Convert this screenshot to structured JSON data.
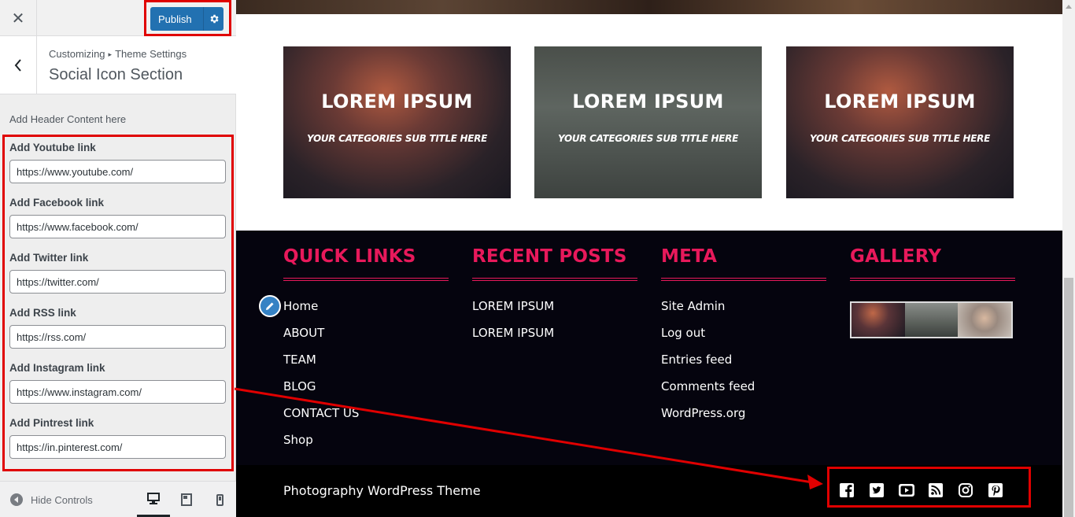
{
  "sidebar": {
    "close_label": "✕",
    "publish_label": "Publish",
    "breadcrumb_root": "Customizing",
    "breadcrumb_parent": "Theme Settings",
    "section_title": "Social Icon Section",
    "description": "Add Header Content here",
    "fields": [
      {
        "label": "Add Youtube link",
        "value": "https://www.youtube.com/"
      },
      {
        "label": "Add Facebook link",
        "value": "https://www.facebook.com/"
      },
      {
        "label": "Add Twitter link",
        "value": "https://twitter.com/"
      },
      {
        "label": "Add RSS link",
        "value": "https://rss.com/"
      },
      {
        "label": "Add Instagram link",
        "value": "https://www.instagram.com/"
      },
      {
        "label": "Add Pintrest link",
        "value": "https://in.pinterest.com/"
      }
    ],
    "hide_controls": "Hide Controls"
  },
  "preview": {
    "cards": [
      {
        "title": "LOREM IPSUM",
        "subtitle": "YOUR CATEGORIES SUB TITLE HERE"
      },
      {
        "title": "LOREM IPSUM",
        "subtitle": "YOUR CATEGORIES SUB TITLE HERE"
      },
      {
        "title": "LOREM IPSUM",
        "subtitle": "YOUR CATEGORIES SUB TITLE HERE"
      }
    ],
    "footer": {
      "quick_links_title": "QUICK LINKS",
      "quick_links": [
        "Home",
        "ABOUT",
        "TEAM",
        "BLOG",
        "CONTACT US",
        "Shop"
      ],
      "recent_posts_title": "RECENT POSTS",
      "recent_posts": [
        "LOREM IPSUM",
        "LOREM IPSUM"
      ],
      "meta_title": "META",
      "meta_links": [
        "Site Admin",
        "Log out",
        "Entries feed",
        "Comments feed",
        "WordPress.org"
      ],
      "gallery_title": "GALLERY",
      "copyright": "Photography WordPress Theme",
      "social_icons": [
        "facebook-icon",
        "twitter-icon",
        "youtube-icon",
        "rss-icon",
        "instagram-icon",
        "pinterest-icon"
      ]
    }
  },
  "colors": {
    "accent": "#e8195b",
    "publish": "#2271b1",
    "highlight": "#e00000",
    "footer_bg": "#05040e"
  }
}
